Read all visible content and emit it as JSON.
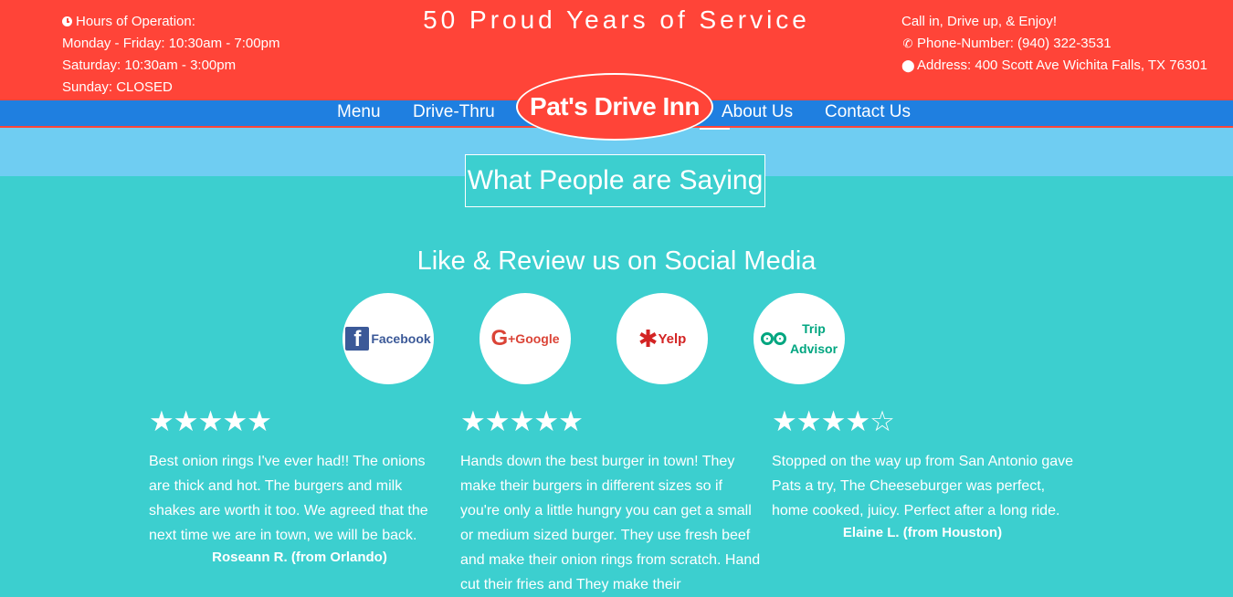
{
  "header": {
    "hours_title": "Hours of Operation:",
    "hours": [
      "Monday - Friday: 10:30am - 7:00pm",
      "Saturday: 10:30am - 3:00pm",
      "Sunday: CLOSED"
    ],
    "tagline": "50 Proud Years of Service",
    "contact": {
      "intro": "Call in, Drive up, & Enjoy!",
      "phone": "Phone-Number: (940) 322-3531",
      "address": "Address: 400 Scott Ave Wichita Falls, TX 76301"
    }
  },
  "nav": {
    "items": [
      "Menu",
      "Drive-Thru",
      "About Us",
      "Contact Us"
    ],
    "logo": "Pat's Drive Inn"
  },
  "section": {
    "heading": "What People are Saying",
    "social_title": "Like & Review us on Social Media"
  },
  "social": {
    "facebook": {
      "glyph": "f",
      "label": "Facebook"
    },
    "google": {
      "glyph": "G",
      "label": "+Google"
    },
    "yelp": {
      "glyph": "✱",
      "label": "Yelp"
    },
    "tripadvisor": {
      "line1": "Trip",
      "line2": "Advisor"
    }
  },
  "reviews": [
    {
      "stars": "★★★★★",
      "rating": 5,
      "text": "Best onion rings I've ever had!! The onions are thick and hot. The burgers and milk shakes are worth it too. We agreed that the next time we are in town, we will be back.",
      "author": "Roseann R. (from Orlando)"
    },
    {
      "stars": "★★★★★",
      "rating": 5,
      "text": "Hands down the best burger in town! They make their burgers in different sizes so if you're only a little hungry you can get a small or medium sized burger. They use fresh beef and make their onion rings from scratch. Hand cut their fries and They make their",
      "author": ""
    },
    {
      "stars": "★★★★☆",
      "rating": 4,
      "text": "Stopped on the way up from San Antonio gave Pats a try, The Cheeseburger was perfect, home cooked, juicy. Perfect after a long ride.",
      "author": "Elaine L. (from Houston)"
    }
  ],
  "colors": {
    "red": "#ff4438",
    "nav_blue": "#1f7fe0",
    "band_blue": "#6fcdf2",
    "teal": "#3ccfcf"
  }
}
